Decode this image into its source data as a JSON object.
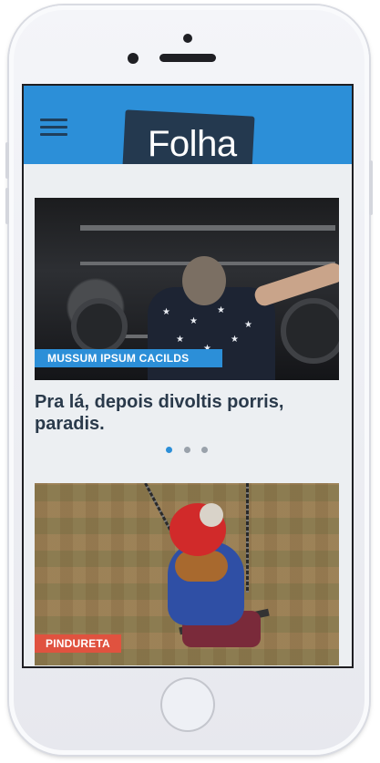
{
  "header": {
    "logo_text": "Folha"
  },
  "carousel": {
    "tag": "MUSSUM IPSUM CACILDS",
    "headline": "Pra lá, depois divoltis porris, paradis.",
    "dots_count": 3,
    "active_dot": 0
  },
  "second_card": {
    "tag": "Pindureta"
  },
  "colors": {
    "header_blue": "#2c8fd8",
    "logo_bg": "#24394f",
    "tag_red": "#e0523f",
    "headline": "#2a3a4b",
    "background": "#eceff2"
  },
  "icons": [
    "hamburger-menu-icon"
  ]
}
